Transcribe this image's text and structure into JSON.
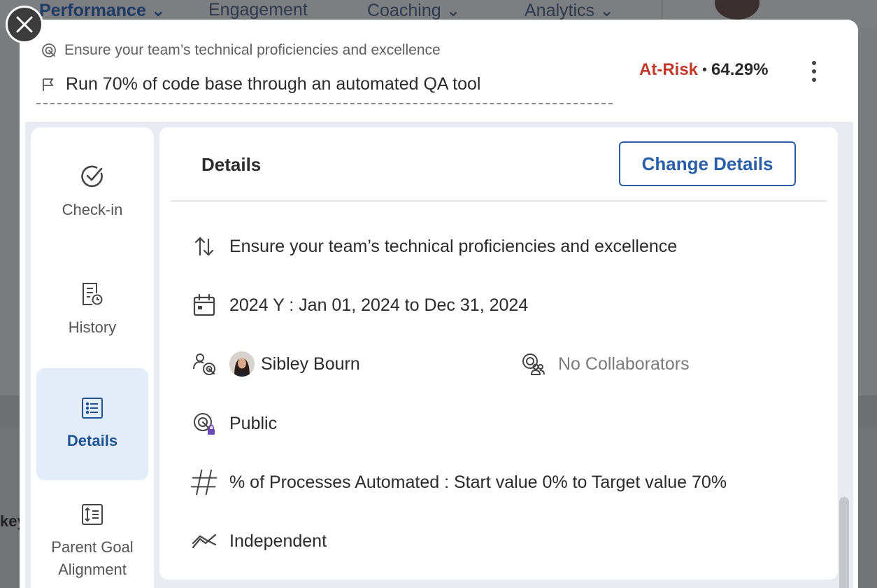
{
  "background": {
    "nav": [
      "Performance",
      "Engagement",
      "Coaching",
      "Analytics"
    ],
    "left_fragment": "key"
  },
  "modal": {
    "parent_goal": "Ensure your team’s technical proficiencies and excellence",
    "goal_title": "Run 70% of code base through an automated QA tool",
    "status": {
      "label": "At-Risk",
      "separator": "•",
      "progress_text": "64.29%",
      "progress": 64.29,
      "color": "#c0392b"
    },
    "side_tabs": [
      {
        "label": "Check-in",
        "icon": "check-circle-icon"
      },
      {
        "label": "History",
        "icon": "history-doc-icon"
      },
      {
        "label": "Details",
        "icon": "list-doc-icon",
        "active": true
      },
      {
        "label": "Parent Goal Alignment",
        "icon": "alignment-doc-icon"
      }
    ],
    "details": {
      "heading": "Details",
      "change_button": "Change Details",
      "alignment": "Ensure your team’s technical proficiencies and excellence",
      "period": "2024 Y : Jan 01, 2024 to Dec 31, 2024",
      "owner": "Sibley Bourn",
      "collaborators": "No Collaborators",
      "visibility": "Public",
      "metric": "% of Processes Automated : Start value 0% to Target value 70%",
      "progress_type": "Independent"
    }
  },
  "colors": {
    "accent": "#2a5fa8",
    "active_tab_bg": "#e3edf9",
    "at_risk": "#c0392b"
  }
}
